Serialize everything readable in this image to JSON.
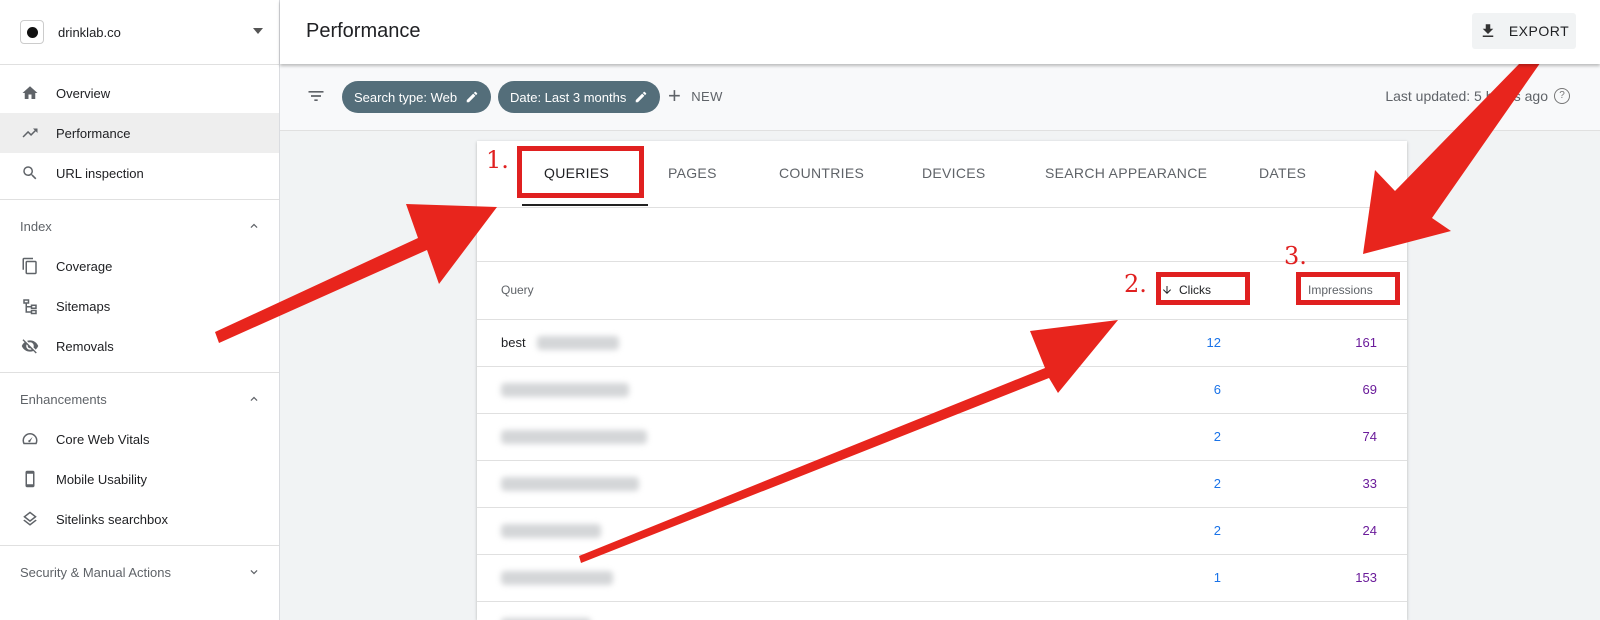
{
  "property": {
    "name": "drinklab.co"
  },
  "sidebar": {
    "top_items": [
      {
        "label": "Overview",
        "icon": "home-icon"
      },
      {
        "label": "Performance",
        "icon": "trending-up-icon",
        "active": true
      },
      {
        "label": "URL inspection",
        "icon": "search-icon"
      }
    ],
    "index": {
      "title": "Index",
      "items": [
        {
          "label": "Coverage",
          "icon": "copy-pages-icon"
        },
        {
          "label": "Sitemaps",
          "icon": "sitemap-icon"
        },
        {
          "label": "Removals",
          "icon": "eye-off-icon"
        }
      ]
    },
    "enhancements": {
      "title": "Enhancements",
      "items": [
        {
          "label": "Core Web Vitals",
          "icon": "speedometer-icon"
        },
        {
          "label": "Mobile Usability",
          "icon": "phone-icon"
        },
        {
          "label": "Sitelinks searchbox",
          "icon": "layers-icon"
        }
      ]
    },
    "security": {
      "title": "Security & Manual Actions"
    }
  },
  "header": {
    "title": "Performance",
    "export_label": "EXPORT"
  },
  "filters": {
    "chips": [
      {
        "label": "Search type: Web"
      },
      {
        "label": "Date: Last 3 months"
      }
    ],
    "new_label": "NEW",
    "last_updated": "Last updated: 5 hours ago"
  },
  "tabs": [
    "QUERIES",
    "PAGES",
    "COUNTRIES",
    "DEVICES",
    "SEARCH APPEARANCE",
    "DATES"
  ],
  "table": {
    "headers": {
      "query": "Query",
      "clicks": "Clicks",
      "impressions": "Impressions"
    },
    "rows": [
      {
        "query": "best",
        "clicks": "12",
        "impressions": "161"
      },
      {
        "query": "",
        "clicks": "6",
        "impressions": "69"
      },
      {
        "query": "",
        "clicks": "2",
        "impressions": "74"
      },
      {
        "query": "",
        "clicks": "2",
        "impressions": "33"
      },
      {
        "query": "",
        "clicks": "2",
        "impressions": "24"
      },
      {
        "query": "",
        "clicks": "1",
        "impressions": "153"
      }
    ]
  },
  "annotations": {
    "labels": [
      "1.",
      "2.",
      "3."
    ],
    "color": "#e02020"
  },
  "colors": {
    "chip": "#546e7a",
    "clicks": "#1a73e8",
    "impressions": "#6a1b9a"
  }
}
